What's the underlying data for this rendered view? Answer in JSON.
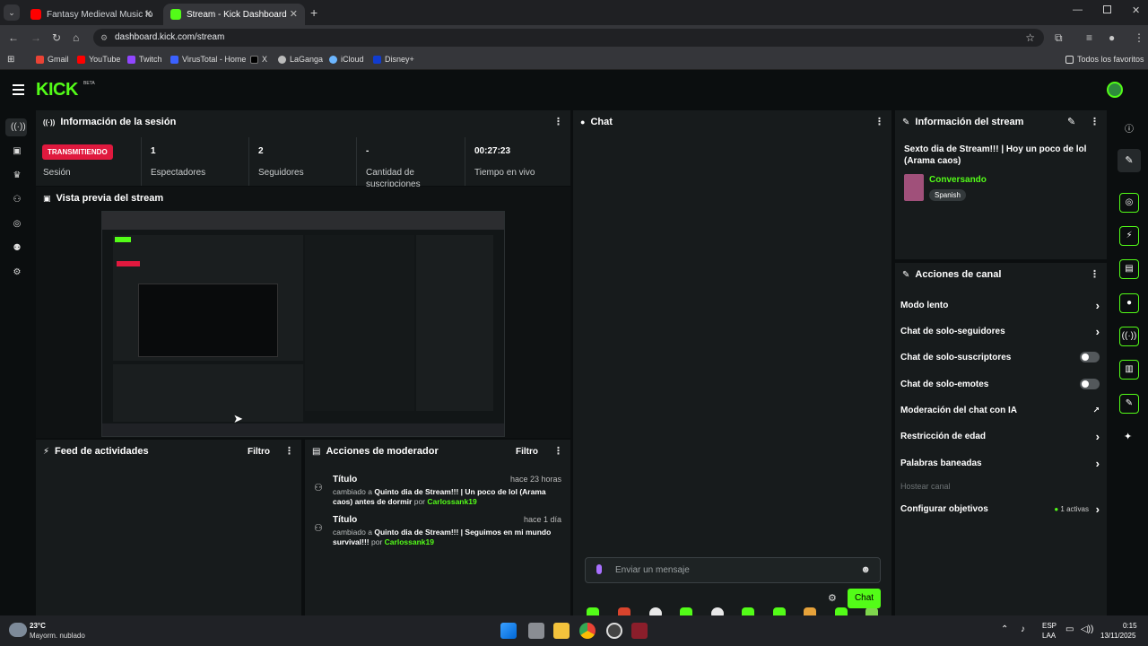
{
  "browser": {
    "tabs": [
      {
        "label": "Fantasy Medieval Music for Foc",
        "active": false
      },
      {
        "label": "Stream - Kick Dashboard",
        "active": true
      }
    ],
    "url": "dashboard.kick.com/stream",
    "bookmarks": [
      "Gmail",
      "YouTube",
      "Twitch",
      "VirusTotal - Home",
      "X",
      "LaGanga",
      "iCloud",
      "Disney+"
    ],
    "all_bookmarks": "Todos los favoritos"
  },
  "app": {
    "logo": "KICK",
    "logo_beta": "BETA"
  },
  "session": {
    "title": "Información de la sesión",
    "status": "TRANSMITIENDO",
    "status_label": "Sesión",
    "stats": [
      {
        "value": "1",
        "label": "Espectadores"
      },
      {
        "value": "2",
        "label": "Seguidores"
      },
      {
        "value": "-",
        "label": "Cantidad de suscripciones"
      },
      {
        "value": "00:27:23",
        "label": "Tiempo en vivo"
      }
    ]
  },
  "preview": {
    "title": "Vista previa del stream"
  },
  "feed": {
    "title": "Feed de actividades",
    "filter": "Filtro"
  },
  "mod": {
    "title": "Acciones de moderador",
    "filter": "Filtro",
    "items": [
      {
        "title": "Título",
        "ago": "hace 23 horas",
        "prefix": "cambiado a",
        "value": "Quinto dia de Stream!!! | Un poco de lol (Arama caos) antes de dormir",
        "by": "por",
        "user": "Carlossank19"
      },
      {
        "title": "Título",
        "ago": "hace 1 día",
        "prefix": "cambiado a",
        "value": "Quinto dia de Stream!!! | Seguimos en mi mundo survival!!!",
        "by": "por",
        "user": "Carlossank19"
      }
    ]
  },
  "chat": {
    "title": "Chat",
    "placeholder": "Enviar un mensaje",
    "send": "Chat"
  },
  "stream_info": {
    "title": "Información del stream",
    "stream_title": "Sexto dia de Stream!!! | Hoy un poco de lol (Arama caos)",
    "category": "Conversando",
    "language": "Spanish"
  },
  "channel_actions": {
    "title": "Acciones de canal",
    "items": [
      {
        "label": "Modo lento",
        "control": "chevron"
      },
      {
        "label": "Chat de solo-seguidores",
        "control": "chevron"
      },
      {
        "label": "Chat de solo-suscriptores",
        "control": "toggle"
      },
      {
        "label": "Chat de solo-emotes",
        "control": "toggle"
      },
      {
        "label": "Moderación del chat con IA",
        "control": "external"
      },
      {
        "label": "Restricción de edad",
        "control": "chevron"
      },
      {
        "label": "Palabras baneadas",
        "control": "chevron"
      },
      {
        "label": "Hostear canal",
        "control": "none"
      },
      {
        "label": "Configurar objetivos",
        "control": "chevron"
      }
    ],
    "goals_active": "1 activas"
  },
  "taskbar": {
    "temp": "23°C",
    "weather": "Mayorm. nublado",
    "lang": "ESP",
    "lang2": "LAA",
    "time": "0:15",
    "date": "13/11/2025"
  },
  "colors": {
    "accent": "#53fc18",
    "live": "#e0193e",
    "panel": "#171b1c",
    "bg": "#0b0e0f"
  }
}
